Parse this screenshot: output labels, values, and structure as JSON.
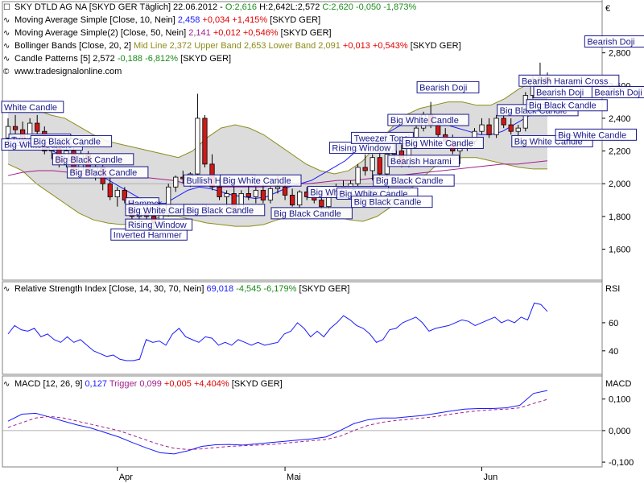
{
  "header": {
    "symbol_line": "SKY DTLD AG NA [SKYD GER  Täglich] 22.06.2012 -",
    "ohlc": {
      "o": "O:2,616",
      "h": "H:2,642",
      "l": "L:2,572",
      "c": "C:2,620",
      "chg": "-0,050",
      "pct": "-1,873%"
    },
    "currency": "€",
    "website": "www.tradesignalonline.com"
  },
  "indicators": [
    {
      "label": "Moving Average Simple [Close, 10, Nein]",
      "value": "2,458",
      "chg": "+0,034",
      "pct": "+1,415%",
      "tag": "[SKYD GER]",
      "color": "#1a1aff"
    },
    {
      "label": "Moving Average Simple(2) [Close, 50, Nein]",
      "value": "2,141",
      "chg": "+0,012",
      "pct": "+0,546%",
      "tag": "[SKYD GER]",
      "color": "#a0208c"
    },
    {
      "label": "Bollinger Bands [Close, 20, 2]",
      "extra": "Mid Line 2,372 Upper Band 2,653 Lower Band 2,091",
      "chg": "+0,013",
      "pct": "+0,543%",
      "tag": "[SKYD GER]",
      "color": "#8c8c1a"
    },
    {
      "label": "Candle Patterns [5]",
      "value": "2,572",
      "chg": "-0,188",
      "pct": "-6,812%",
      "tag": "[SKYD GER]",
      "color": "#000000"
    }
  ],
  "rsi_header": {
    "label": "Relative Strength Index [Close, 14, 30, 70, Nein]",
    "value": "69,018",
    "chg": "-4,545",
    "pct": "-6,179%",
    "tag": "[SKYD GER]",
    "axis_title": "RSI"
  },
  "macd_header": {
    "label": "MACD [12, 26, 9]",
    "value": "0,127",
    "trigger_label": "Trigger",
    "trigger": "0,099",
    "chg": "+0,005",
    "pct": "+4,404%",
    "tag": "[SKYD GER]",
    "axis_title": "MACD"
  },
  "colors": {
    "up": "#ffffff",
    "down": "#d01818",
    "ma10": "#1a1aff",
    "ma50": "#a0208c",
    "bollinger": "#8c8c1a",
    "band_fill": "#dcdcdc",
    "rsi": "#1a1aff",
    "macd": "#1a1aff",
    "trigger": "#a0208c"
  },
  "chart_data": [
    {
      "type": "candlestick",
      "title": "SKY DTLD AG NA [SKYD GER  Täglich]",
      "ylim": [
        1.45,
        3.0
      ],
      "yticks": [
        "1,600",
        "1,800",
        "2,000",
        "2,200",
        "2,400",
        "2,600",
        "2,800"
      ],
      "xticks": [
        "Apr",
        "Mai",
        "Jun"
      ],
      "xtick_index": [
        15,
        38,
        65
      ],
      "candles": [
        [
          2.28,
          2.4,
          2.26,
          2.35
        ],
        [
          2.35,
          2.42,
          2.3,
          2.33
        ],
        [
          2.33,
          2.38,
          2.25,
          2.27
        ],
        [
          2.27,
          2.4,
          2.25,
          2.37
        ],
        [
          2.37,
          2.42,
          2.3,
          2.32
        ],
        [
          2.32,
          2.35,
          2.18,
          2.2
        ],
        [
          2.2,
          2.26,
          2.15,
          2.23
        ],
        [
          2.23,
          2.25,
          2.1,
          2.12
        ],
        [
          2.12,
          2.22,
          2.1,
          2.2
        ],
        [
          2.2,
          2.22,
          2.06,
          2.08
        ],
        [
          2.08,
          2.2,
          2.05,
          2.18
        ],
        [
          2.18,
          2.2,
          2.05,
          2.07
        ],
        [
          2.07,
          2.12,
          2.02,
          2.1
        ],
        [
          2.1,
          2.12,
          1.96,
          2.0
        ],
        [
          2.0,
          2.06,
          1.9,
          1.92
        ],
        [
          1.92,
          1.98,
          1.86,
          1.96
        ],
        [
          1.96,
          1.98,
          1.88,
          1.9
        ],
        [
          1.9,
          1.9,
          1.74,
          1.8
        ],
        [
          1.8,
          1.84,
          1.76,
          1.82
        ],
        [
          1.82,
          1.86,
          1.78,
          1.8
        ],
        [
          1.8,
          1.82,
          1.68,
          1.76
        ],
        [
          1.76,
          1.84,
          1.74,
          1.82
        ],
        [
          1.82,
          2.0,
          1.8,
          1.98
        ],
        [
          1.98,
          2.05,
          1.95,
          2.04
        ],
        [
          2.04,
          2.08,
          2.0,
          2.03
        ],
        [
          2.03,
          2.07,
          1.98,
          2.06
        ],
        [
          2.06,
          2.55,
          2.05,
          2.4
        ],
        [
          2.4,
          2.42,
          2.1,
          2.12
        ],
        [
          2.12,
          2.18,
          1.96,
          1.98
        ],
        [
          1.98,
          2.04,
          1.9,
          1.92
        ],
        [
          1.92,
          1.96,
          1.86,
          1.94
        ],
        [
          1.94,
          2.0,
          1.82,
          1.84
        ],
        [
          1.84,
          1.96,
          1.82,
          1.94
        ],
        [
          1.94,
          2.0,
          1.9,
          1.92
        ],
        [
          1.92,
          1.98,
          1.88,
          1.96
        ],
        [
          1.96,
          2.0,
          1.88,
          1.9
        ],
        [
          1.9,
          1.98,
          1.88,
          1.97
        ],
        [
          1.97,
          2.05,
          1.94,
          1.98
        ],
        [
          1.98,
          2.0,
          1.9,
          1.93
        ],
        [
          1.93,
          1.97,
          1.86,
          1.87
        ],
        [
          1.87,
          1.96,
          1.85,
          1.95
        ],
        [
          1.95,
          1.98,
          1.9,
          1.92
        ],
        [
          1.92,
          1.96,
          1.88,
          1.9
        ],
        [
          1.9,
          1.93,
          1.84,
          1.86
        ],
        [
          1.86,
          1.94,
          1.84,
          1.93
        ],
        [
          1.93,
          2.0,
          1.91,
          1.98
        ],
        [
          1.98,
          2.02,
          1.92,
          1.94
        ],
        [
          1.94,
          2.02,
          1.92,
          2.0
        ],
        [
          2.0,
          2.12,
          1.98,
          2.1
        ],
        [
          2.1,
          2.18,
          2.05,
          2.08
        ],
        [
          2.08,
          2.18,
          2.02,
          2.16
        ],
        [
          2.16,
          2.2,
          2.04,
          2.06
        ],
        [
          2.06,
          2.2,
          2.04,
          2.18
        ],
        [
          2.18,
          2.26,
          2.14,
          2.2
        ],
        [
          2.2,
          2.24,
          2.1,
          2.12
        ],
        [
          2.12,
          2.3,
          2.1,
          2.28
        ],
        [
          2.28,
          2.36,
          2.26,
          2.34
        ],
        [
          2.34,
          2.44,
          2.32,
          2.42
        ],
        [
          2.42,
          2.5,
          2.34,
          2.36
        ],
        [
          2.36,
          2.4,
          2.28,
          2.3
        ],
        [
          2.3,
          2.34,
          2.24,
          2.26
        ],
        [
          2.26,
          2.3,
          2.18,
          2.2
        ],
        [
          2.2,
          2.26,
          2.12,
          2.24
        ],
        [
          2.24,
          2.28,
          2.2,
          2.26
        ],
        [
          2.26,
          2.34,
          2.24,
          2.32
        ],
        [
          2.32,
          2.4,
          2.3,
          2.36
        ],
        [
          2.36,
          2.4,
          2.28,
          2.3
        ],
        [
          2.3,
          2.42,
          2.28,
          2.4
        ],
        [
          2.4,
          2.44,
          2.34,
          2.36
        ],
        [
          2.36,
          2.4,
          2.3,
          2.32
        ],
        [
          2.32,
          2.36,
          2.26,
          2.34
        ],
        [
          2.34,
          2.56,
          2.32,
          2.54
        ],
        [
          2.54,
          2.66,
          2.52,
          2.64
        ],
        [
          2.64,
          2.74,
          2.6,
          2.65
        ],
        [
          2.65,
          2.68,
          2.58,
          2.62
        ]
      ],
      "ma10": [
        2.3,
        2.28,
        2.26,
        2.24,
        2.2,
        2.16,
        2.12,
        2.1,
        2.06,
        2.02,
        1.98,
        1.94,
        1.9,
        1.88,
        1.88,
        1.92,
        1.96,
        1.98,
        1.97,
        1.95,
        1.93,
        1.92,
        1.91,
        1.92,
        1.95,
        1.98,
        2.0,
        2.02,
        2.06,
        2.1,
        2.14,
        2.2,
        2.24,
        2.26,
        2.32,
        2.36,
        2.4,
        2.4,
        2.38,
        2.36,
        2.34,
        2.32,
        2.3,
        2.3,
        2.32,
        2.36,
        2.4,
        2.44,
        2.46
      ],
      "ma50": [
        2.05,
        2.07,
        2.08,
        2.08,
        2.07,
        2.06,
        2.05,
        2.04,
        2.04,
        2.04,
        2.03,
        2.02,
        2.0,
        1.99,
        1.98,
        1.98,
        1.98,
        1.98,
        1.99,
        2.0,
        2.0,
        2.01,
        2.02,
        2.02,
        2.03,
        2.04,
        2.05,
        2.06,
        2.07,
        2.08,
        2.09,
        2.1,
        2.11,
        2.12,
        2.12,
        2.13,
        2.14
      ],
      "bb_upper": [
        2.5,
        2.48,
        2.45,
        2.42,
        2.4,
        2.35,
        2.3,
        2.26,
        2.24,
        2.22,
        2.2,
        2.18,
        2.16,
        2.2,
        2.28,
        2.34,
        2.36,
        2.34,
        2.3,
        2.24,
        2.18,
        2.12,
        2.08,
        2.06,
        2.08,
        2.14,
        2.24,
        2.34,
        2.42,
        2.46,
        2.48,
        2.5,
        2.5,
        2.48,
        2.48,
        2.52,
        2.58,
        2.62,
        2.65
      ],
      "bb_lower": [
        2.12,
        2.08,
        2.0,
        1.94,
        1.88,
        1.82,
        1.78,
        1.76,
        1.75,
        1.76,
        1.78,
        1.8,
        1.8,
        1.78,
        1.76,
        1.75,
        1.74,
        1.74,
        1.75,
        1.78,
        1.8,
        1.82,
        1.82,
        1.8,
        1.78,
        1.77,
        1.8,
        1.86,
        1.94,
        2.02,
        2.1,
        2.14,
        2.16,
        2.16,
        2.14,
        2.12,
        2.1,
        2.09,
        2.09
      ]
    },
    {
      "type": "line",
      "title": "Relative Strength Index [Close, 14, 30, 70, Nein]",
      "ylim": [
        25,
        80
      ],
      "yticks": [
        "40",
        "60"
      ],
      "values": [
        52,
        58,
        55,
        54,
        56,
        50,
        52,
        48,
        46,
        50,
        46,
        48,
        44,
        40,
        38,
        36,
        37,
        34,
        33,
        33,
        34,
        48,
        46,
        47,
        44,
        52,
        56,
        50,
        48,
        46,
        50,
        49,
        44,
        46,
        44,
        48,
        46,
        44,
        46,
        44,
        45,
        46,
        52,
        54,
        60,
        56,
        50,
        54,
        50,
        56,
        60,
        65,
        62,
        58,
        56,
        52,
        46,
        48,
        55,
        56,
        60,
        62,
        64,
        60,
        54,
        56,
        57,
        58,
        60,
        62,
        61,
        58,
        60,
        62,
        64,
        60,
        62,
        60,
        64,
        62,
        74,
        73,
        68
      ]
    },
    {
      "type": "line",
      "title": "MACD [12, 26, 9]",
      "ylim": [
        -0.11,
        0.135
      ],
      "yticks": [
        "-0,100",
        "0,000",
        "0,100"
      ],
      "series": [
        {
          "name": "MACD",
          "values": [
            0.03,
            0.052,
            0.055,
            0.043,
            0.03,
            0.018,
            0.008,
            -0.006,
            -0.02,
            -0.038,
            -0.055,
            -0.07,
            -0.074,
            -0.064,
            -0.05,
            -0.045,
            -0.044,
            -0.046,
            -0.042,
            -0.038,
            -0.034,
            -0.03,
            -0.026,
            -0.02,
            0.0,
            0.022,
            0.034,
            0.04,
            0.04,
            0.044,
            0.048,
            0.055,
            0.062,
            0.068,
            0.07,
            0.07,
            0.072,
            0.08,
            0.118,
            0.127
          ]
        },
        {
          "name": "Trigger",
          "values": [
            0.01,
            0.025,
            0.04,
            0.045,
            0.04,
            0.03,
            0.02,
            0.01,
            0.0,
            -0.015,
            -0.03,
            -0.045,
            -0.056,
            -0.06,
            -0.058,
            -0.054,
            -0.05,
            -0.048,
            -0.046,
            -0.044,
            -0.04,
            -0.036,
            -0.032,
            -0.028,
            -0.018,
            0.0,
            0.016,
            0.026,
            0.032,
            0.036,
            0.04,
            0.045,
            0.052,
            0.058,
            0.063,
            0.066,
            0.068,
            0.072,
            0.086,
            0.099
          ]
        }
      ]
    }
  ],
  "patterns": [
    {
      "text": "White Candle",
      "i": 0,
      "price": 2.45
    },
    {
      "text": "Tweezer Tops",
      "i": 1,
      "price": 2.25
    },
    {
      "text": "Big White Candle",
      "i": 0,
      "price": 2.22
    },
    {
      "text": "Big Black Candle",
      "i": 4,
      "price": 2.24
    },
    {
      "text": "Big Black Candle",
      "i": 7,
      "price": 2.13
    },
    {
      "text": "Big Black Candle",
      "i": 9,
      "price": 2.05
    },
    {
      "text": "Hammer",
      "i": 17,
      "price": 1.86
    },
    {
      "text": "Big White Candle",
      "i": 17,
      "price": 1.82
    },
    {
      "text": "Inverted Hammer",
      "i": 15,
      "price": 1.67
    },
    {
      "text": "Rising Window",
      "i": 17,
      "price": 1.73
    },
    {
      "text": "Bullish Harami",
      "i": 25,
      "price": 2.0
    },
    {
      "text": "Big Black Candle",
      "i": 25,
      "price": 1.82
    },
    {
      "text": "Big White Candle",
      "i": 30,
      "price": 2.0
    },
    {
      "text": "Big White Candle",
      "i": 42,
      "price": 1.93
    },
    {
      "text": "Big Black Candle",
      "i": 37,
      "price": 1.8
    },
    {
      "text": "Big White Candle",
      "i": 46,
      "price": 1.92
    },
    {
      "text": "Big Black Candle",
      "i": 48,
      "price": 1.87
    },
    {
      "text": "Rising Window",
      "i": 45,
      "price": 2.2
    },
    {
      "text": "Tweezer Tops",
      "i": 48,
      "price": 2.26
    },
    {
      "text": "Bearish Harami",
      "i": 53,
      "price": 2.12
    },
    {
      "text": "Big Black Candle",
      "i": 51,
      "price": 2.0
    },
    {
      "text": "Big White Candle",
      "i": 55,
      "price": 2.23
    },
    {
      "text": "Big White Candle",
      "i": 53,
      "price": 2.37
    },
    {
      "text": "Bearish Doji",
      "i": 57,
      "price": 2.57
    },
    {
      "text": "Big White Candle",
      "i": 70,
      "price": 2.24
    },
    {
      "text": "Big Black Candle",
      "i": 68,
      "price": 2.43
    },
    {
      "text": "Bearish Harami Cross",
      "i": 71,
      "price": 2.61
    },
    {
      "text": "Bearish Doji",
      "i": 73,
      "price": 2.54
    },
    {
      "text": "Big Black Candle",
      "i": 72,
      "price": 2.46
    },
    {
      "text": "Big White Candle",
      "i": 76,
      "price": 2.28
    },
    {
      "text": "Bearish Doji",
      "i": 80,
      "price": 2.85
    },
    {
      "text": "Bearish Doji",
      "i": 81,
      "price": 2.54
    }
  ]
}
